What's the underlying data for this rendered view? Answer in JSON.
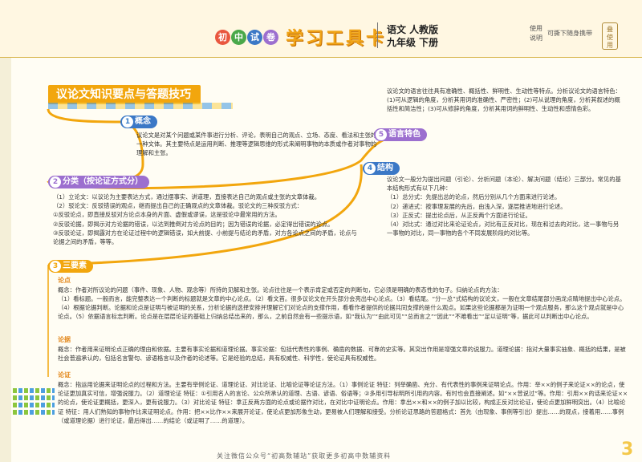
{
  "header": {
    "brand_chars": [
      "初",
      "中",
      "试",
      "卷"
    ],
    "title": "学习工具卡",
    "subject_line1": "语文  人教版",
    "subject_line2": "九年级 下册",
    "usage_label_1": "使用",
    "usage_label_2": "说明",
    "usage_tip": "可撕下随身携带",
    "seal_text": "叠 使 用"
  },
  "banner": {
    "title": "议论文知识要点与答题技巧"
  },
  "sections": {
    "s1": {
      "num": "1",
      "label": "概念"
    },
    "s2": {
      "num": "2",
      "label": "分类（按论证方式分）"
    },
    "s3": {
      "num": "3",
      "label": "三要素"
    },
    "s4": {
      "num": "4",
      "label": "结构"
    },
    "s5": {
      "num": "5",
      "label": "语言特色"
    }
  },
  "concept_text": "议论文是对某个问题或某件事进行分析、评论，表明自己的观点、立场、态度、看法和主张的一种文体。其主要特点是运用判断、推理等逻辑思维的形式来阐明事物的本质或作者对事物的理解和主张。",
  "language_text": "议论文的语言往往具有准确性、概括性、鲜明性、生动性等特点。分析议论文的语言特色：(1)可从逻辑的角度，分析其用词的准确性、严密性；(2)可从说理的角度，分析其叙述的概括性和简洁性；(3)可从修辞的角度，分析其用词的鲜明性、生动性和感情色彩。",
  "classification": [
    "（1）立论文：以议论为主要表达方式，通过摆事实、讲道理，直接表达自己的观点或主张的文章体裁。",
    "（2）驳论文：反驳错误的观点，继而提出自己的正确观点的文章体裁。驳论文的三种反驳方式：",
    "①反驳论点，即直接反驳对方论点本身的片面、虚假或谬误，这是驳论中最常用的方法。",
    "②反驳论据，即揭示对方论据的错误，以达到推倒对方论点的目的；因为错误的论据，必定得出错误的论点。",
    "③反驳论证，即揭露对方在论证过程中的逻辑错误，如大前提、小前提与结论的矛盾，对方各论点之间的矛盾，论点与论据之间的矛盾，等等。"
  ],
  "structure": [
    "议论文一般分为提出问题（引论）、分析问题（本论）、解决问题（结论）三部分。常见的基本结构形式有以下几种：",
    "（1）总分式：先提出总的论点，然后分别从几个方面来进行论述。",
    "（2）递进式：按事理发展的先后，由浅入深，逐层推进地进行论述。",
    "（3）正反式：提出论点后，从正反两个方面进行论证。",
    "（4）对比式：通过对比来论证论点，对比有正反对比，现在和过去的对比，这一事物与另一事物的对比，同一事物的各个不同发展阶段的对比等。"
  ],
  "elements": {
    "argument_title": "论点",
    "argument_text": "概念：作者对所议论的问题（事件、现象、人物、观念等）所持的见解和主张。论点往往是一个表示肯定或否定的判断句，它必须是明确的表态性的句子。归纳论点的方法：",
    "argument_methods": "（1）看标题。一般而言，能完整表达一个判断的标题就是文章的中心论点。（2）看文首。很多议论文在开头部分会亮出中心论点。（3）看结尾。“分—总”式结构的议论文，一般在文章结尾部分画龙点睛地提出中心论点。（4）根据论据判断。论据和论点是证明与被证明的关系，分析论据的选择安排并理解它们对论点的支撑作用，看看作者提供的论据共同支撑的是什么观点。如果这些论据都是为证明一个观点服务，那么这个观点就是中心论点。（5）依据语言标志判断。论点是在层层论证的基础上归纳总结出来的，那么，之前自然会有一些提示语，如“我认为”“由此可见”“总而言之”“因此”“不难看出”“足以证明”等，据此可以判断出中心论点。",
    "evidence_title": "论据",
    "evidence_text": "概念：作者用来证明论点正确的理由和依据。主要有事实论据和道理论据。事实论据：包括代表性的事例、确凿的数据、可靠的史实等。其突出作用是增强文章的说服力。道理论据：指对大量事实抽象、概括的结果，是被社会普遍承认的，包括名言警句、谚语格言以及作者的论述等。它是经验的总结，具有权威性、科学性，使论证具有权威性。",
    "proof_title": "论证",
    "proof_text": "概念：指运用论据来证明论点的过程和方法。主要有举例论证、道理论证、对比论证、比喻论证等论证方法。（1）事例论证  特征：列举确凿、充分、有代表性的事例来证明论点。作用：举××的例子来论证××的论点，使论证更加真实可信，增强说服力。（2）道理论证  特征：①引用名人的言论、公众所承认的道理、古语、谚语、俗语等；②多用引导标明所引用的内容。有时也会直接阐述。如“××曾说过”等。作用：引用××的话来论证××的论点，使论证更概括，更深入，更有说服力。（3）对比论证  特征：拿正反两方面的论点或论据作对比，在对比中证明论点。作用：拿出××和××的例子加以比较，构成正反对比论证，使论点更加鲜明突出。（4）比喻论证  特征：用人们熟知的事物作比来证明论点。作用：把××比作××来展开论证，使论点更加形象生动，更易被人们理解和接受。分析论证思路的答题格式：首先（由现象、事例等引出）提出……的观点，接着用……事例（或道理论据）进行论证，最后得出……的结论（或证明了……的道理）。"
  },
  "footer": {
    "text": "关注微信公众号“初高数辅站”获取更多初高中数辅资料",
    "page_number": "3"
  },
  "colors": {
    "orange": "#f2a60d",
    "blue": "#3b78c6",
    "purple": "#9c6fcf",
    "green": "#4aa84a",
    "yellow": "#f4c84a"
  }
}
